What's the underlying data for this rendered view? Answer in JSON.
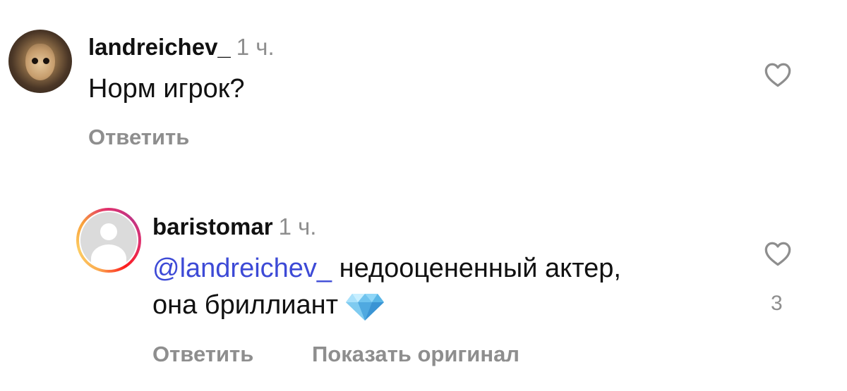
{
  "comments": [
    {
      "username": "landreichev_",
      "time": "1 ч.",
      "text": "Норм игрок?",
      "actions": [
        "Ответить"
      ],
      "like_count": ""
    },
    {
      "username": "baristomar",
      "time": "1 ч.",
      "mention": "@landreichev_",
      "text_line1": " недооцененный актер,",
      "text_line2": "она бриллиант",
      "emoji": "gem-stone",
      "actions": [
        "Ответить",
        "Показать оригинал"
      ],
      "like_count": "3"
    }
  ],
  "icons": {
    "like": "heart-outline-icon",
    "gem": "gem-stone-icon"
  },
  "colors": {
    "username": "#111111",
    "secondary": "#8e8e8e",
    "mention": "#3d4ad6",
    "story_ring": [
      "#fbad50",
      "#e1306c",
      "#c13584"
    ]
  }
}
